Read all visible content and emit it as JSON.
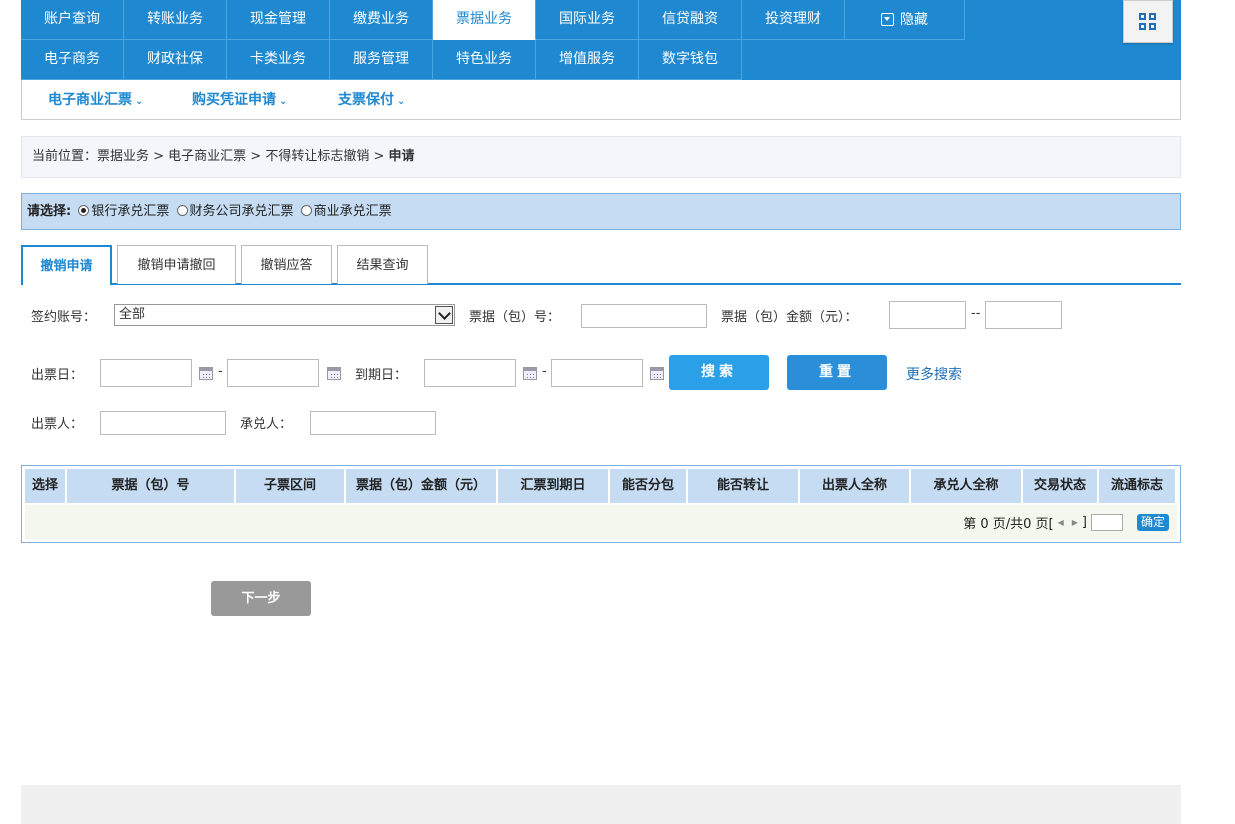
{
  "nav": {
    "row1": [
      "账户查询",
      "转账业务",
      "现金管理",
      "缴费业务",
      "票据业务",
      "国际业务",
      "信贷融资",
      "投资理财"
    ],
    "hide_label": "隐藏",
    "row2": [
      "电子商务",
      "财政社保",
      "卡类业务",
      "服务管理",
      "特色业务",
      "增值服务",
      "数字钱包"
    ],
    "active": "票据业务"
  },
  "subnav": [
    "电子商业汇票",
    "购买凭证申请",
    "支票保付"
  ],
  "breadcrumb": {
    "prefix": "当前位置：票据业务 > 电子商业汇票 > 不得转让标志撤销 > ",
    "current": "申请"
  },
  "choose": {
    "label": "请选择:",
    "options": [
      "银行承兑汇票",
      "财务公司承兑汇票",
      "商业承兑汇票"
    ],
    "selected": 0
  },
  "tabs": [
    "撤销申请",
    "撤销申请撤回",
    "撤销应答",
    "结果查询"
  ],
  "form": {
    "account_label": "签约账号：",
    "account_value": "全部",
    "bill_no_label": "票据（包）号：",
    "amount_label": "票据（包）金额（元）：",
    "range_sep": "--",
    "dash": "-",
    "issue_date_label": "出票日：",
    "due_date_label": "到期日：",
    "search_button": "搜索",
    "reset_button": "重置",
    "more_search": "更多搜索",
    "drawer_label": "出票人：",
    "acceptor_label": "承兑人："
  },
  "table": {
    "headers": [
      "选择",
      "票据（包）号",
      "子票区间",
      "票据（包）金额（元）",
      "汇票到期日",
      "能否分包",
      "能否转让",
      "出票人全称",
      "承兑人全称",
      "交易状态",
      "流通标志"
    ],
    "pager_text": "第 0 页/共0 页[",
    "pager_close": "]",
    "ok_button": "确定"
  },
  "next_button": "下一步",
  "colors": {
    "primary": "#1e88d0",
    "header_bg": "#c5dcf3"
  }
}
